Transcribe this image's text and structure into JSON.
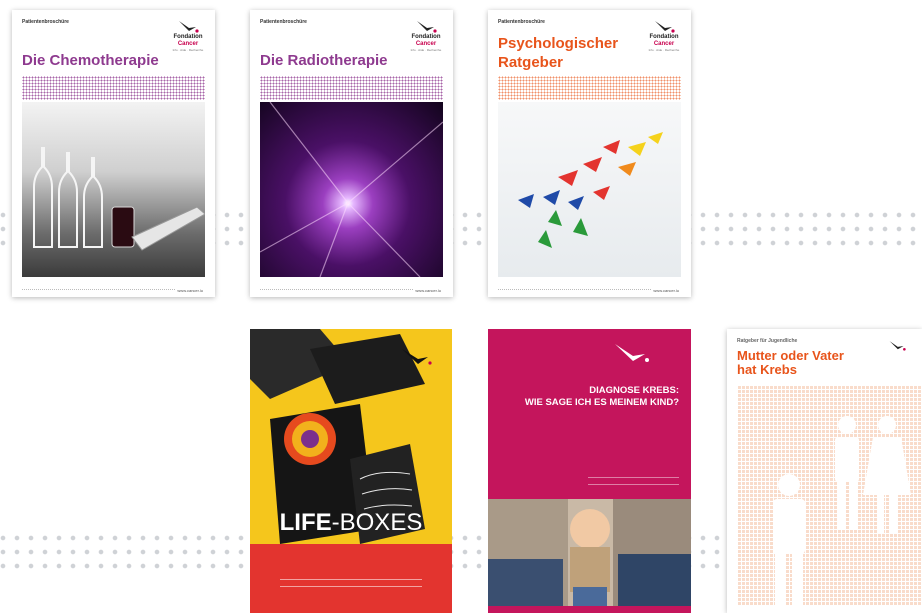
{
  "colors": {
    "purple": "#8e3a8f",
    "orange": "#e8541b",
    "yellow": "#f5c61c",
    "red": "#e3342f",
    "magenta": "#c4155c",
    "logo_pink": "#c8004e",
    "peach": "#f8c9b0"
  },
  "logo": {
    "line1": "Fondation",
    "line2": "Cancer",
    "line3": "Info · Aide · Recherche"
  },
  "brochures": [
    {
      "tag": "Patientenbroschüre",
      "title": "Die Chemotherapie",
      "footer": "www.cancer.lu",
      "image": "chemotherapy-ampoules-photo"
    },
    {
      "tag": "Patientenbroschüre",
      "title": "Die Radiotherapie",
      "footer": "www.cancer.lu",
      "image": "radiotherapy-light-beams-photo"
    },
    {
      "tag": "Patientenbroschüre",
      "title_line1": "Psychologischer",
      "title_line2": "Ratgeber",
      "footer": "www.cancer.lu",
      "image": "paper-boats-photo"
    },
    {
      "title": "LIFE-BOXES",
      "title_part1": "LIFE",
      "title_part2": "-BOXES",
      "image": "gift-boxes-photo"
    },
    {
      "title_line1": "DIAGNOSE KREBS:",
      "title_line2": "WIE SAGE ICH ES MEINEM KIND?",
      "image": "parents-child-photo"
    },
    {
      "tag": "Ratgeber für Jugendliche",
      "title_line1": "Mutter oder Vater",
      "title_line2": "hat Krebs",
      "image": "family-pictogram"
    }
  ]
}
